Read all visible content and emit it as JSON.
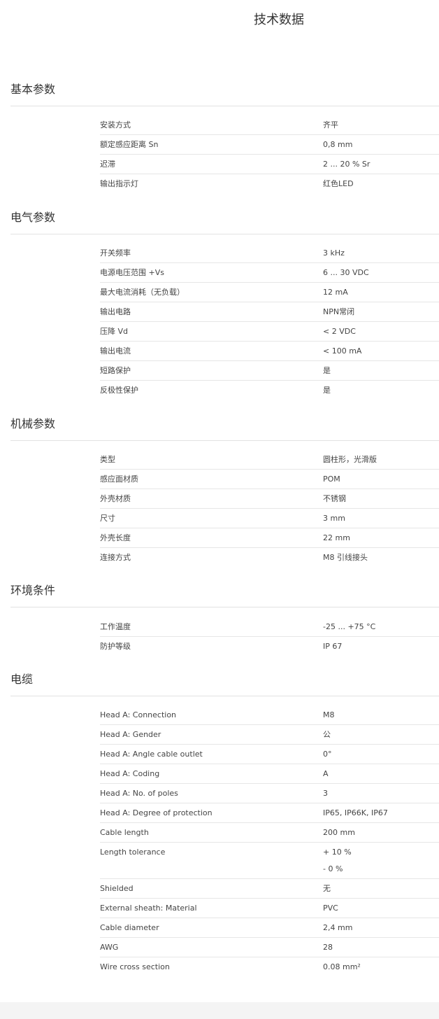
{
  "page": {
    "title": "技术数据"
  },
  "sections": [
    {
      "title": "基本参数",
      "rows": [
        {
          "label": "安装方式",
          "value": "齐平"
        },
        {
          "label": "额定感应距离 Sn",
          "value": "0,8 mm"
        },
        {
          "label": "迟滞",
          "value": "2 ... 20 % Sr"
        },
        {
          "label": "输出指示灯",
          "value": "红色LED"
        }
      ]
    },
    {
      "title": "电气参数",
      "rows": [
        {
          "label": "开关频率",
          "value": "3 kHz"
        },
        {
          "label": "电源电压范围 +Vs",
          "value": "6 ... 30 VDC"
        },
        {
          "label": "最大电流消耗（无负载）",
          "value": "12 mA"
        },
        {
          "label": "输出电路",
          "value": "NPN常闭"
        },
        {
          "label": "压降 Vd",
          "value": "< 2 VDC"
        },
        {
          "label": "输出电流",
          "value": "< 100 mA"
        },
        {
          "label": "短路保护",
          "value": "是"
        },
        {
          "label": "反极性保护",
          "value": "是"
        }
      ]
    },
    {
      "title": "机械参数",
      "rows": [
        {
          "label": "类型",
          "value": "圆柱形，光滑版"
        },
        {
          "label": "感应面材质",
          "value": "POM"
        },
        {
          "label": "外壳材质",
          "value": "不锈钢"
        },
        {
          "label": "尺寸",
          "value": "3 mm"
        },
        {
          "label": "外壳长度",
          "value": "22 mm"
        },
        {
          "label": "连接方式",
          "value": "M8 引线接头"
        }
      ]
    },
    {
      "title": "环境条件",
      "rows": [
        {
          "label": "工作温度",
          "value": "-25 ... +75 °C"
        },
        {
          "label": "防护等级",
          "value": "IP 67"
        }
      ]
    },
    {
      "title": "电缆",
      "rows": [
        {
          "label": "Head A: Connection",
          "value": "M8"
        },
        {
          "label": "Head A: Gender",
          "value": "公"
        },
        {
          "label": "Head A: Angle cable outlet",
          "value": "0°"
        },
        {
          "label": "Head A: Coding",
          "value": "A"
        },
        {
          "label": "Head A: No. of poles",
          "value": "3"
        },
        {
          "label": "Head A: Degree of protection",
          "value": "IP65, IP66K, IP67"
        },
        {
          "label": "Cable length",
          "value": "200 mm"
        },
        {
          "label": "Length tolerance",
          "value": "+ 10 %",
          "value2": "- 0 %"
        },
        {
          "label": "Shielded",
          "value": "无"
        },
        {
          "label": "External sheath: Material",
          "value": "PVC"
        },
        {
          "label": "Cable diameter",
          "value": "2,4 mm"
        },
        {
          "label": "AWG",
          "value": "28"
        },
        {
          "label": "Wire cross section",
          "value": "0.08 mm²"
        }
      ]
    }
  ]
}
